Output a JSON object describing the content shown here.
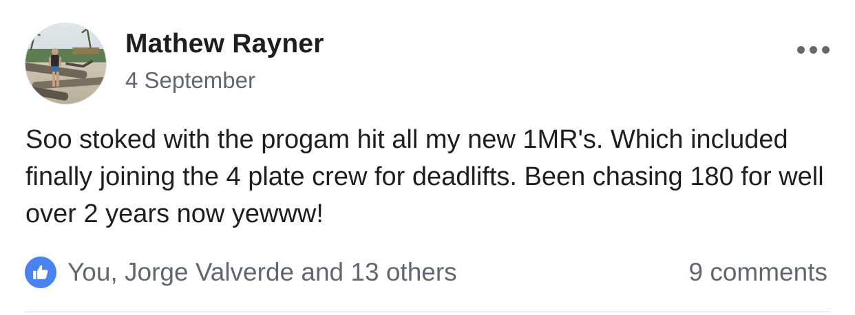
{
  "post": {
    "author_name": "Mathew Rayner",
    "date": "4 September",
    "text": "Soo stoked with the progam hit all my new 1MR's. Which included finally joining the 4 plate crew for deadlifts. Been chasing 180 for well over 2 years now yewww!",
    "reactions_summary": "You, Jorge Valverde and 13 others",
    "comments_count": "9 comments"
  },
  "icons": {
    "more": "more-horizontal-icon",
    "like": "thumbs-up-icon"
  },
  "colors": {
    "like_blue": "#4a82f0",
    "secondary_text": "#606770",
    "primary_text": "#1c1e21"
  }
}
